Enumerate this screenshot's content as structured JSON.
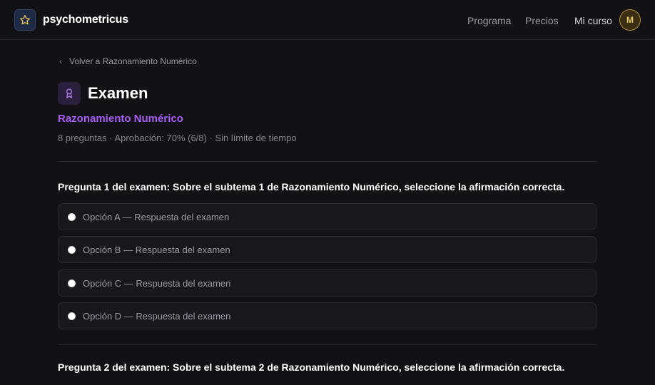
{
  "header": {
    "brand": "psychometricus",
    "nav": [
      "Programa",
      "Precios",
      "Mi curso"
    ],
    "avatar_initial": "M"
  },
  "back_link": "Volver a Razonamiento Numérico",
  "exam": {
    "title": "Examen",
    "subject": "Razonamiento Numérico",
    "meta": "8 preguntas · Aprobación: 70% (6/8) · Sin límite de tiempo"
  },
  "questions": [
    {
      "text": "Pregunta 1 del examen: Sobre el subtema 1 de Razonamiento Numérico, seleccione la afirmación correcta.",
      "options": [
        "Opción A — Respuesta del examen",
        "Opción B — Respuesta del examen",
        "Opción C — Respuesta del examen",
        "Opción D — Respuesta del examen"
      ]
    },
    {
      "text": "Pregunta 2 del examen: Sobre el subtema 2 de Razonamiento Numérico, seleccione la afirmación correcta."
    }
  ],
  "colors": {
    "accent": "#a85cf0",
    "background": "#121216",
    "avatar": "#e7c56b"
  },
  "icons": {
    "brand": "star-icon",
    "exam": "award-icon",
    "back": "chevron-left-icon"
  }
}
